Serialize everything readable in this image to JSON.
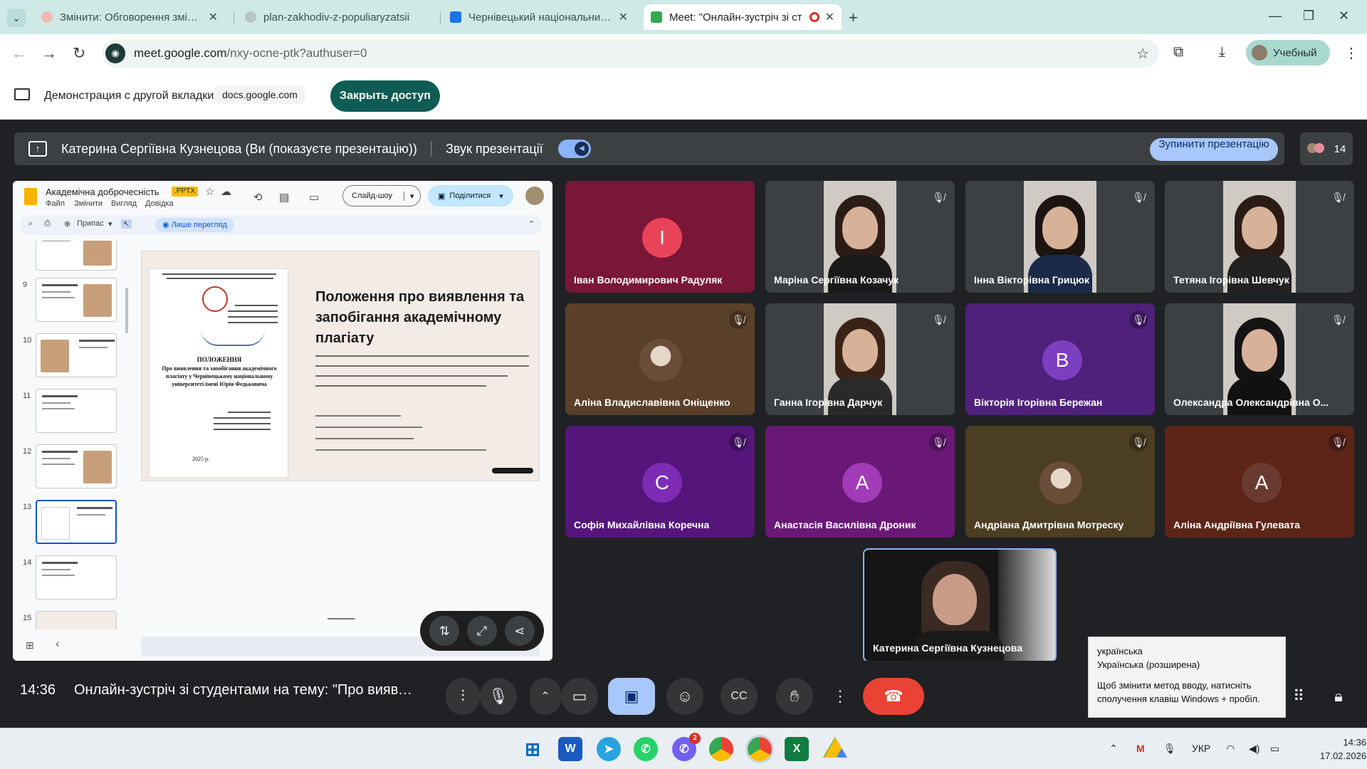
{
  "browser": {
    "tabs": [
      {
        "title": "Змінити: Обговорення змін до",
        "icon_color": "#f2b8b5",
        "active": false
      },
      {
        "title": "plan-zakhodiv-z-populiaryzatsii",
        "icon_color": "#b9c4c2",
        "active": false
      },
      {
        "title": "Чернівецький національний у",
        "icon_color": "#1a73e8",
        "active": false
      },
      {
        "title": "Meet: \"Онлайн-зустріч зі ст",
        "icon_color": "#34a853",
        "active": true
      }
    ],
    "url_main": "meet.google.com",
    "url_rest": "/nxy-ocne-ptk?authuser=0",
    "profile_label": "Учебный"
  },
  "share_bar": {
    "label": "Демонстрация с другой вкладки:",
    "domain": "docs.google.com",
    "close_button": "Закрыть доступ"
  },
  "presenting": {
    "text": "Катерина Сергіївна Кузнецова (Ви (показуєте презентацію))",
    "sound_label": "Звук презентації",
    "stop_button": "Зупинити презентацію",
    "people_count": "14"
  },
  "slides_app": {
    "doc_title": "Академічна доброчесність",
    "badge": ".PPTX",
    "menu": [
      "Файл",
      "Змінити",
      "Вигляд",
      "Довідка"
    ],
    "slideshow_label": "Слайд-шоу",
    "share_label": "Поділитися",
    "zoom_label": "Припас",
    "readonly_label": "Лише перегляд",
    "slide_numbers": [
      "9",
      "10",
      "11",
      "12",
      "13",
      "14",
      "15"
    ],
    "selected_slide": "13",
    "slide": {
      "title": "Положення про виявлення та запобігання академічному плагіату",
      "doc_heading_1": "ПОЛОЖЕННЯ",
      "doc_heading_2": "Про виявлення та запобігання академічного плагіату у Чернівецькому національному університеті імені Юрія Федьковича",
      "doc_footer": "2025 р."
    }
  },
  "participants": [
    {
      "name": "Іван Володимирович Радуляк",
      "type": "letter",
      "letter": "І",
      "bg": "#7a1638",
      "circle": "#e94359",
      "muted": false
    },
    {
      "name": "Маріна Сергіївна Козачук",
      "type": "camera",
      "bg": "#3c4043",
      "muted": true,
      "hair": "#2b1d16",
      "shirt": "#1a1a1a"
    },
    {
      "name": "Інна Вікторівна Грицюк",
      "type": "camera",
      "bg": "#3c4043",
      "muted": true,
      "hair": "#1c1410",
      "shirt": "#1b2a48"
    },
    {
      "name": "Тетяна Ігорівна Шевчук",
      "type": "camera",
      "bg": "#3c4043",
      "muted": true,
      "hair": "#2a1b14",
      "shirt": "#222222"
    },
    {
      "name": "Аліна Владиславівна Оніщенко",
      "type": "photo",
      "bg": "#5a4028",
      "muted": true
    },
    {
      "name": "Ганна Ігорівна Дарчук",
      "type": "camera",
      "bg": "#3c4043",
      "muted": true,
      "hair": "#3b2417",
      "shirt": "#2a2a2a"
    },
    {
      "name": "Вікторія Ігорівна Бережан",
      "type": "letter",
      "letter": "В",
      "bg": "#4f217a",
      "circle": "#7b3fc0",
      "muted": true
    },
    {
      "name": "Олександра Олександрівна О...",
      "type": "camera",
      "bg": "#3c4043",
      "muted": true,
      "hair": "#141414",
      "shirt": "#111111"
    },
    {
      "name": "Софія Михайлівна Коречна",
      "type": "letter",
      "letter": "С",
      "bg": "#54167a",
      "circle": "#7e2bb5",
      "muted": true
    },
    {
      "name": "Анастасія Василівна Дроник",
      "type": "letter",
      "letter": "А",
      "bg": "#6a1877",
      "circle": "#a13bb8",
      "muted": true
    },
    {
      "name": "Андріана Дмитрівна Мотреску",
      "type": "photo",
      "bg": "#4c3e22",
      "muted": true
    },
    {
      "name": "Аліна Андріївна Гулевата",
      "type": "letter",
      "letter": "А",
      "bg": "#5c2518",
      "circle": "#6a3a30",
      "muted": true
    }
  ],
  "self_view": {
    "name": "Катерина Сергіївна Кузнецова"
  },
  "bottom": {
    "time": "14:36",
    "meeting_title": "Онлайн-зустріч зі студентами на тему: \"Про виявлення та запобігання академічного плагіату\""
  },
  "ime_tooltip": {
    "line1": "українська",
    "line2": "Українська (розширена)",
    "line3": "Щоб змінити метод вводу, натисніть сполучення клавіш Windows + пробіл."
  },
  "taskbar": {
    "lang": "УКР",
    "time": "14:36",
    "date": "17.02.2026",
    "viber_badge": "2"
  }
}
